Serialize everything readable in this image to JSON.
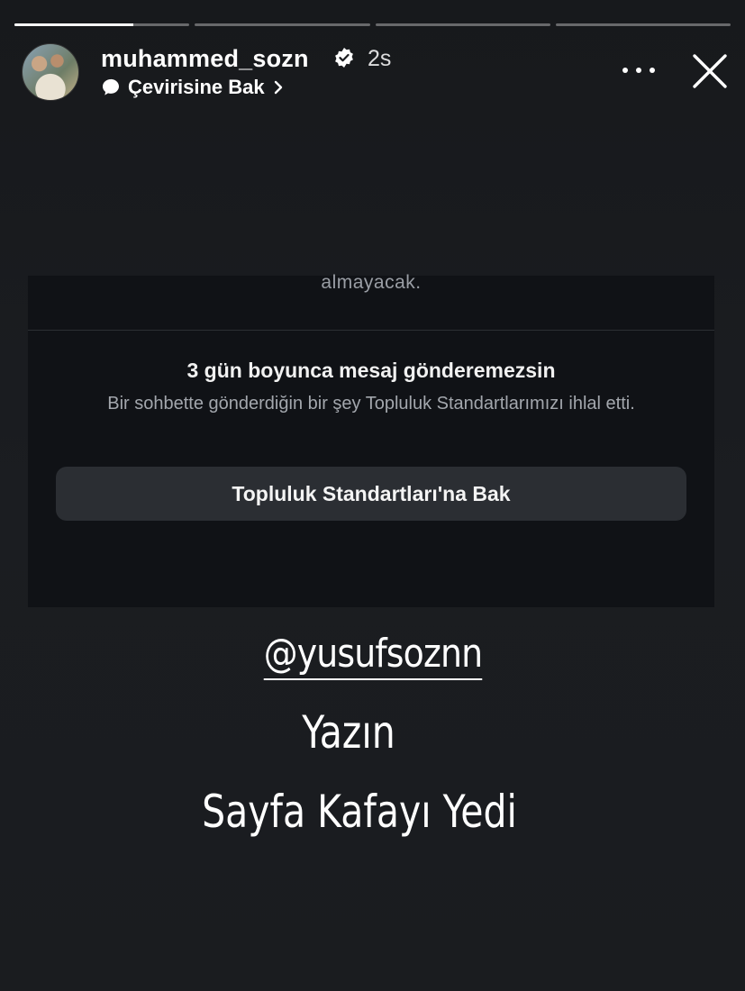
{
  "story": {
    "progress": [
      1,
      0,
      0,
      0
    ],
    "progress_active": 0.68,
    "username": "muhammed_sozn",
    "verified": true,
    "timestamp": "2s",
    "translate_label": "Çevirisine Bak",
    "icons": [
      "verified-badge-icon",
      "translate-bubble-icon",
      "chevron-right-icon",
      "more-icon",
      "close-icon"
    ]
  },
  "screenshot": {
    "cut_text": "almayacak.",
    "title": "3 gün boyunca mesaj gönderemezsin",
    "description": "Bir sohbette gönderdiğin bir şey Topluluk Standartlarımızı ihlal etti.",
    "button_label": "Topluluk Standartları'na Bak"
  },
  "overlay": {
    "mention": "@yusufsoznn",
    "line1": "Yazın",
    "line2": "Sayfa Kafayı Yedi"
  },
  "colors": {
    "background": "#1a1c1f",
    "panel": "#101216",
    "button": "#2b2e33",
    "text": "#ffffff",
    "muted": "#a3a7ad"
  }
}
